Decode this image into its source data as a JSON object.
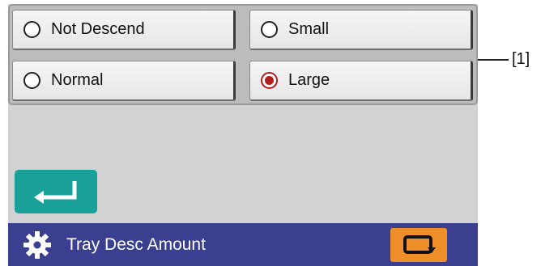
{
  "options": [
    {
      "label": "Not Descend",
      "selected": false
    },
    {
      "label": "Small",
      "selected": false
    },
    {
      "label": "Normal",
      "selected": false
    },
    {
      "label": "Large",
      "selected": true
    }
  ],
  "footer": {
    "title": "Tray Desc Amount"
  },
  "callout": "[1]",
  "icons": {
    "enter": "enter-arrow-icon",
    "settings": "gear-icon",
    "switch": "switch-screen-icon"
  },
  "colors": {
    "accent_teal": "#1aa29a",
    "footer_bg": "#3a3f8f",
    "orange": "#ef8f2a",
    "radio_selected": "#b11e1e"
  }
}
